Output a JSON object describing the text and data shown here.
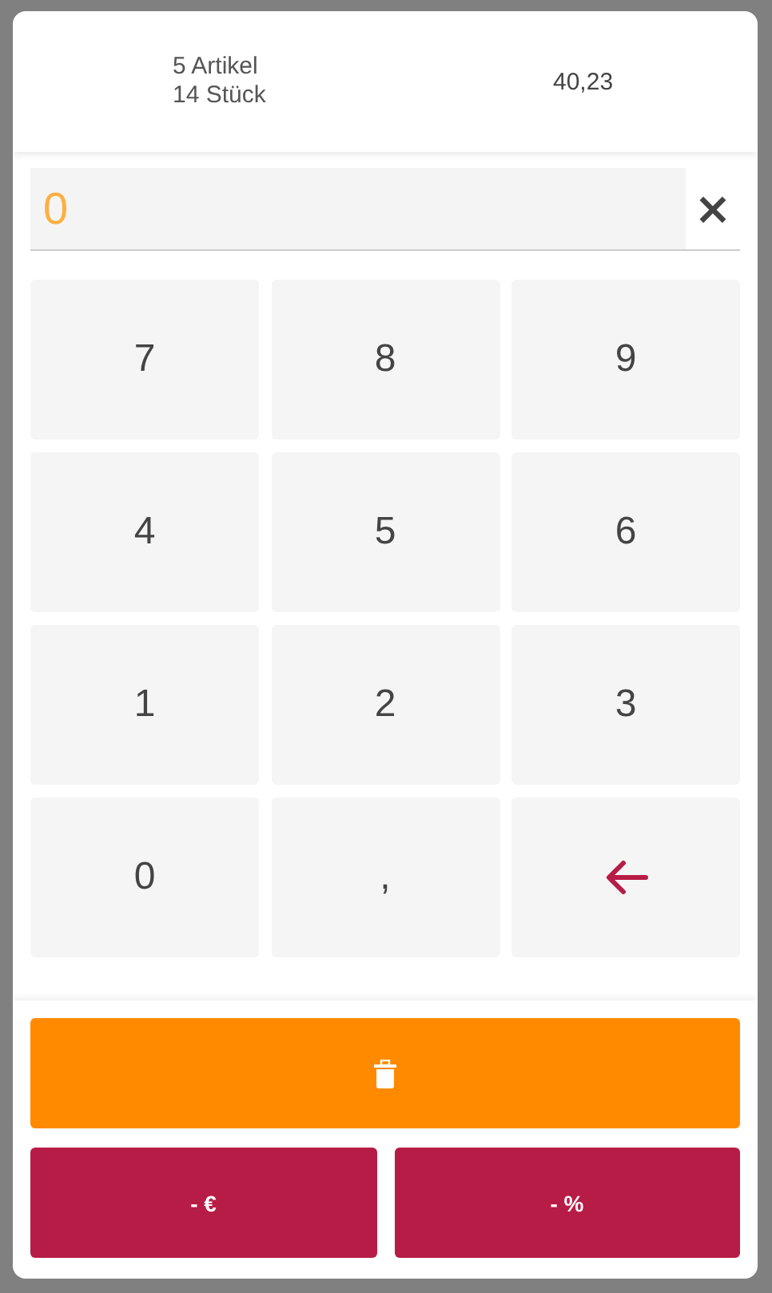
{
  "summary": {
    "articles": "5 Artikel",
    "pieces": "14 Stück",
    "total": "40,23"
  },
  "input": {
    "value": "0",
    "clear": "×"
  },
  "keys": [
    {
      "kind": "digit",
      "label": "7"
    },
    {
      "kind": "digit",
      "label": "8"
    },
    {
      "kind": "digit",
      "label": "9"
    },
    {
      "kind": "digit",
      "label": "4"
    },
    {
      "kind": "digit",
      "label": "5"
    },
    {
      "kind": "digit",
      "label": "6"
    },
    {
      "kind": "digit",
      "label": "1"
    },
    {
      "kind": "digit",
      "label": "2"
    },
    {
      "kind": "digit",
      "label": "3"
    },
    {
      "kind": "digit",
      "label": "0"
    },
    {
      "kind": "digit",
      "label": ","
    },
    {
      "kind": "backspace"
    }
  ],
  "actions": {
    "discount_buttons": [
      "- €",
      "- %"
    ]
  }
}
